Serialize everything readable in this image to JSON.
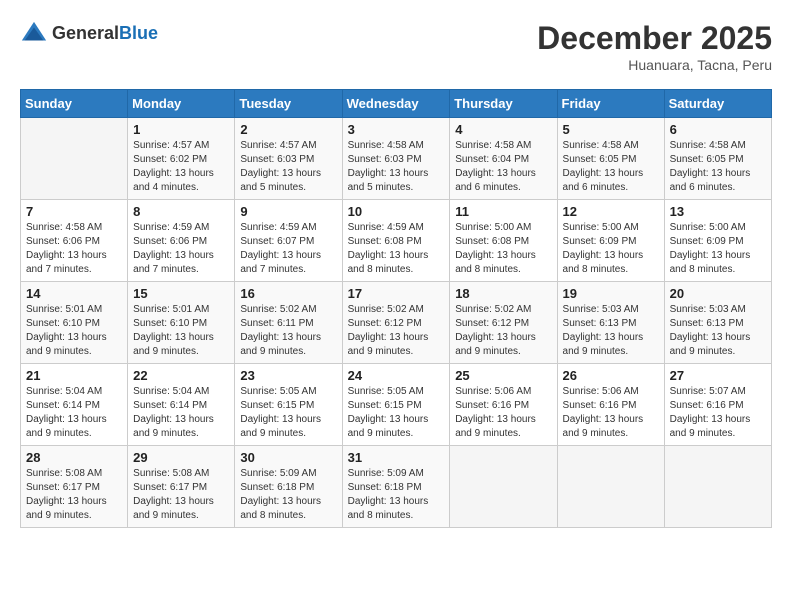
{
  "header": {
    "logo": {
      "general": "General",
      "blue": "Blue"
    },
    "title": "December 2025",
    "location": "Huanuara, Tacna, Peru"
  },
  "weekdays": [
    "Sunday",
    "Monday",
    "Tuesday",
    "Wednesday",
    "Thursday",
    "Friday",
    "Saturday"
  ],
  "weeks": [
    [
      null,
      {
        "date": "1",
        "sunrise": "4:57 AM",
        "sunset": "6:02 PM",
        "daylight": "13 hours and 4 minutes."
      },
      {
        "date": "2",
        "sunrise": "4:57 AM",
        "sunset": "6:03 PM",
        "daylight": "13 hours and 5 minutes."
      },
      {
        "date": "3",
        "sunrise": "4:58 AM",
        "sunset": "6:03 PM",
        "daylight": "13 hours and 5 minutes."
      },
      {
        "date": "4",
        "sunrise": "4:58 AM",
        "sunset": "6:04 PM",
        "daylight": "13 hours and 6 minutes."
      },
      {
        "date": "5",
        "sunrise": "4:58 AM",
        "sunset": "6:05 PM",
        "daylight": "13 hours and 6 minutes."
      },
      {
        "date": "6",
        "sunrise": "4:58 AM",
        "sunset": "6:05 PM",
        "daylight": "13 hours and 6 minutes."
      }
    ],
    [
      {
        "date": "7",
        "sunrise": "4:58 AM",
        "sunset": "6:06 PM",
        "daylight": "13 hours and 7 minutes."
      },
      {
        "date": "8",
        "sunrise": "4:59 AM",
        "sunset": "6:06 PM",
        "daylight": "13 hours and 7 minutes."
      },
      {
        "date": "9",
        "sunrise": "4:59 AM",
        "sunset": "6:07 PM",
        "daylight": "13 hours and 7 minutes."
      },
      {
        "date": "10",
        "sunrise": "4:59 AM",
        "sunset": "6:08 PM",
        "daylight": "13 hours and 8 minutes."
      },
      {
        "date": "11",
        "sunrise": "5:00 AM",
        "sunset": "6:08 PM",
        "daylight": "13 hours and 8 minutes."
      },
      {
        "date": "12",
        "sunrise": "5:00 AM",
        "sunset": "6:09 PM",
        "daylight": "13 hours and 8 minutes."
      },
      {
        "date": "13",
        "sunrise": "5:00 AM",
        "sunset": "6:09 PM",
        "daylight": "13 hours and 8 minutes."
      }
    ],
    [
      {
        "date": "14",
        "sunrise": "5:01 AM",
        "sunset": "6:10 PM",
        "daylight": "13 hours and 9 minutes."
      },
      {
        "date": "15",
        "sunrise": "5:01 AM",
        "sunset": "6:10 PM",
        "daylight": "13 hours and 9 minutes."
      },
      {
        "date": "16",
        "sunrise": "5:02 AM",
        "sunset": "6:11 PM",
        "daylight": "13 hours and 9 minutes."
      },
      {
        "date": "17",
        "sunrise": "5:02 AM",
        "sunset": "6:12 PM",
        "daylight": "13 hours and 9 minutes."
      },
      {
        "date": "18",
        "sunrise": "5:02 AM",
        "sunset": "6:12 PM",
        "daylight": "13 hours and 9 minutes."
      },
      {
        "date": "19",
        "sunrise": "5:03 AM",
        "sunset": "6:13 PM",
        "daylight": "13 hours and 9 minutes."
      },
      {
        "date": "20",
        "sunrise": "5:03 AM",
        "sunset": "6:13 PM",
        "daylight": "13 hours and 9 minutes."
      }
    ],
    [
      {
        "date": "21",
        "sunrise": "5:04 AM",
        "sunset": "6:14 PM",
        "daylight": "13 hours and 9 minutes."
      },
      {
        "date": "22",
        "sunrise": "5:04 AM",
        "sunset": "6:14 PM",
        "daylight": "13 hours and 9 minutes."
      },
      {
        "date": "23",
        "sunrise": "5:05 AM",
        "sunset": "6:15 PM",
        "daylight": "13 hours and 9 minutes."
      },
      {
        "date": "24",
        "sunrise": "5:05 AM",
        "sunset": "6:15 PM",
        "daylight": "13 hours and 9 minutes."
      },
      {
        "date": "25",
        "sunrise": "5:06 AM",
        "sunset": "6:16 PM",
        "daylight": "13 hours and 9 minutes."
      },
      {
        "date": "26",
        "sunrise": "5:06 AM",
        "sunset": "6:16 PM",
        "daylight": "13 hours and 9 minutes."
      },
      {
        "date": "27",
        "sunrise": "5:07 AM",
        "sunset": "6:16 PM",
        "daylight": "13 hours and 9 minutes."
      }
    ],
    [
      {
        "date": "28",
        "sunrise": "5:08 AM",
        "sunset": "6:17 PM",
        "daylight": "13 hours and 9 minutes."
      },
      {
        "date": "29",
        "sunrise": "5:08 AM",
        "sunset": "6:17 PM",
        "daylight": "13 hours and 9 minutes."
      },
      {
        "date": "30",
        "sunrise": "5:09 AM",
        "sunset": "6:18 PM",
        "daylight": "13 hours and 8 minutes."
      },
      {
        "date": "31",
        "sunrise": "5:09 AM",
        "sunset": "6:18 PM",
        "daylight": "13 hours and 8 minutes."
      },
      null,
      null,
      null
    ]
  ]
}
